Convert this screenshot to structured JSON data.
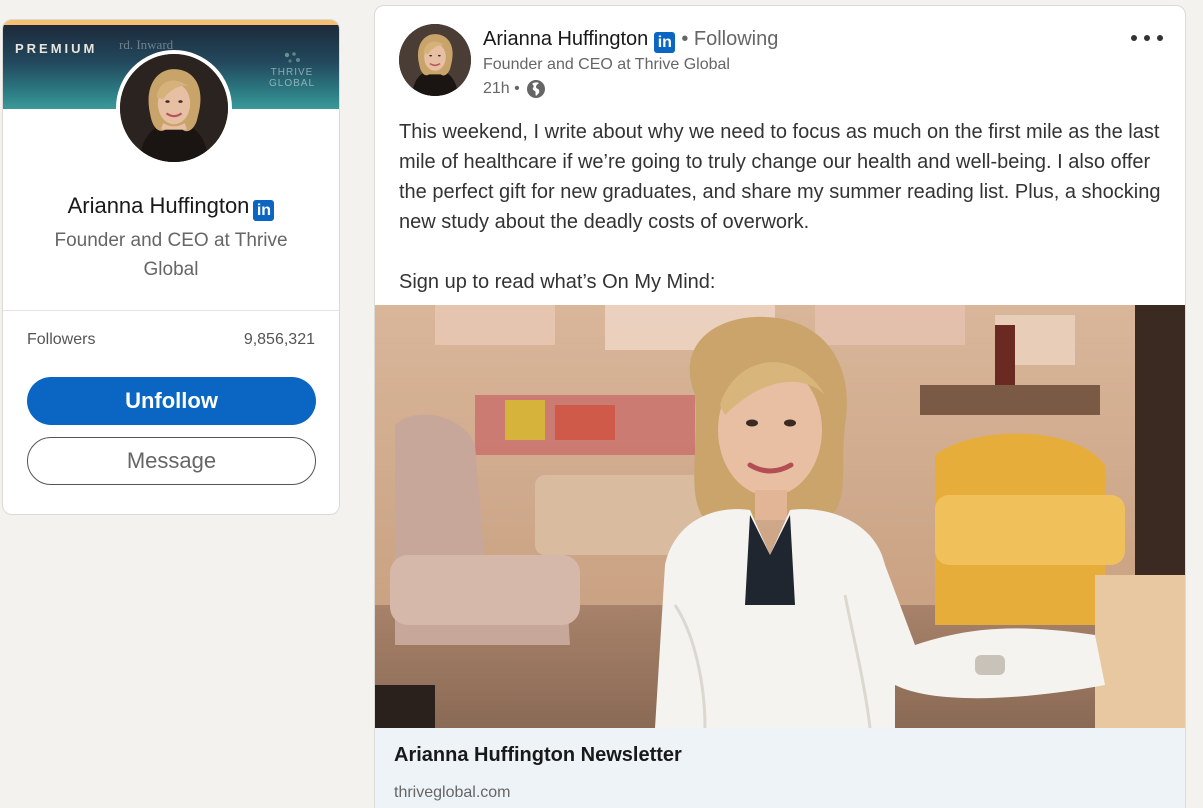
{
  "profile": {
    "banner_label": "PREMIUM",
    "banner_ghost_text": "rd. Inward",
    "brand_logo_text": "THRIVE GLOBAL",
    "name": "Arianna Huffington",
    "headline": "Founder and CEO at Thrive Global",
    "followers_label": "Followers",
    "followers_count": "9,856,321",
    "unfollow_label": "Unfollow",
    "message_label": "Message",
    "linkedin_badge": "in"
  },
  "post": {
    "author_name": "Arianna Huffington",
    "linkedin_badge": "in",
    "follow_state": "• Following",
    "author_headline": "Founder and CEO at Thrive Global",
    "timestamp": "21h •",
    "visibility_icon": "globe-icon",
    "more_icon": "more-dots-icon",
    "body_paragraph_1": "This weekend, I write about why we need to focus as much on the first mile as the last mile of healthcare if we’re going to truly change our health and well-being. I also offer the perfect gift for new graduates, and share my summer reading list. Plus, a shocking new study about the deadly costs of overwork.",
    "body_paragraph_2": "Sign up to read what’s On My Mind:",
    "link_title": "Arianna Huffington Newsletter",
    "link_domain": "thriveglobal.com"
  },
  "colors": {
    "brand_blue": "#0a66c2",
    "page_bg": "#f3f2ef",
    "premium_accent": "#f5c06f",
    "link_card_bg": "#eef3f8"
  }
}
